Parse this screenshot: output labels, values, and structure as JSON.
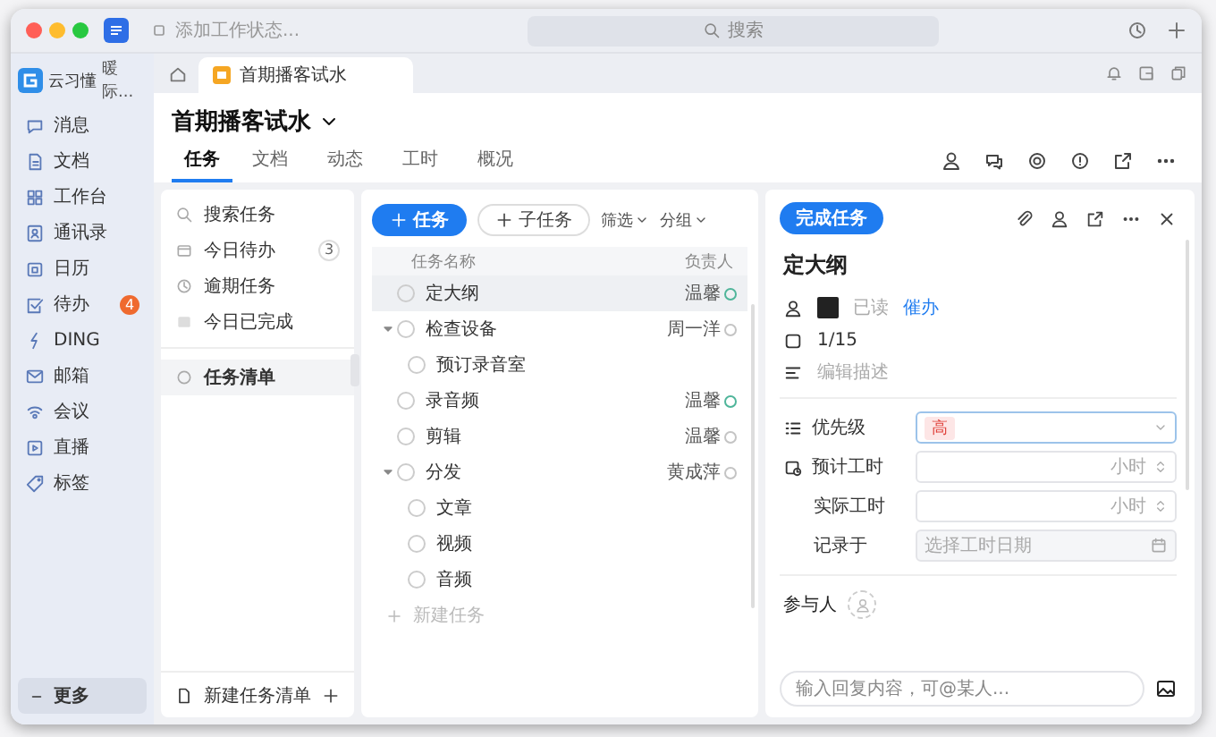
{
  "titlebar": {
    "status_placeholder": "添加工作状态...",
    "search_placeholder": "搜索"
  },
  "org": {
    "name": "云习懂",
    "team": "暖际..."
  },
  "doc_tabs": [
    {
      "label": "首期播客试水",
      "selected": true
    }
  ],
  "nav": {
    "items": [
      {
        "label": "消息"
      },
      {
        "label": "文档"
      },
      {
        "label": "工作台"
      },
      {
        "label": "通讯录"
      },
      {
        "label": "日历"
      },
      {
        "label": "待办",
        "badge": "4"
      },
      {
        "label": "DING"
      },
      {
        "label": "邮箱"
      },
      {
        "label": "会议"
      },
      {
        "label": "直播"
      },
      {
        "label": "标签"
      }
    ],
    "more": "更多"
  },
  "project": {
    "title": "首期播客试水",
    "tabs": [
      {
        "label": "任务",
        "selected": true
      },
      {
        "label": "文档",
        "selected": false
      },
      {
        "label": "动态",
        "selected": false
      },
      {
        "label": "工时",
        "selected": false
      },
      {
        "label": "概况",
        "selected": false
      }
    ]
  },
  "filters": [
    {
      "label": "搜索任务",
      "selected": false
    },
    {
      "label": "今日待办",
      "count": "3",
      "selected": false
    },
    {
      "label": "逾期任务",
      "selected": false
    },
    {
      "label": "今日已完成",
      "selected": false
    }
  ],
  "lists": [
    {
      "label": "任务清单",
      "selected": true
    }
  ],
  "new_list": "新建任务清单",
  "tasks": {
    "add_task": "任务",
    "add_subtask": "子任务",
    "filter": "筛选",
    "group": "分组",
    "columns": [
      "任务名称",
      "负责人"
    ],
    "rows": [
      {
        "name": "定大纲",
        "assignee": "温馨",
        "color": "#4fb59a",
        "selected": true
      },
      {
        "name": "检查设备",
        "assignee": "周一洋",
        "color": "#c4c4c4",
        "selected": false,
        "expanded": true,
        "children": [
          {
            "name": "预订录音室",
            "selected": false
          }
        ]
      },
      {
        "name": "录音频",
        "assignee": "温馨",
        "color": "#4fb59a",
        "selected": false
      },
      {
        "name": "剪辑",
        "assignee": "温馨",
        "color": "#c4c4c4",
        "selected": false
      },
      {
        "name": "分发",
        "assignee": "黄成萍",
        "color": "#c4c4c4",
        "selected": false,
        "expanded": true,
        "children": [
          {
            "name": "文章",
            "selected": false
          },
          {
            "name": "视频",
            "selected": false
          },
          {
            "name": "音频",
            "selected": false
          }
        ]
      }
    ],
    "new_task": "新建任务"
  },
  "detail": {
    "complete": "完成任务",
    "title": "定大纲",
    "read": "已读",
    "urge": "催办",
    "date": "1/15",
    "description_placeholder": "编辑描述",
    "fields": [
      {
        "label": "优先级",
        "kind": "select",
        "value": "高"
      },
      {
        "label": "预计工时",
        "kind": "hours",
        "unit": "小时"
      },
      {
        "label": "实际工时",
        "kind": "hours",
        "unit": "小时"
      },
      {
        "label": "记录于",
        "kind": "date",
        "placeholder": "选择工时日期"
      }
    ],
    "participants": "参与人",
    "comment_placeholder": "输入回复内容，可@某人..."
  }
}
